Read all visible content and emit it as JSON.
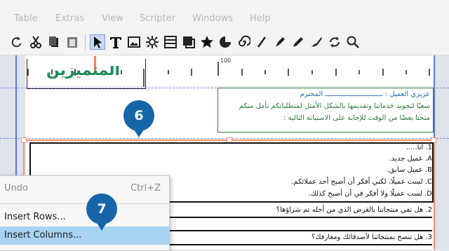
{
  "menubar": {
    "items": [
      {
        "label": "Table"
      },
      {
        "label": "Extras"
      },
      {
        "label": "View"
      },
      {
        "label": "Scripter"
      },
      {
        "label": "Windows"
      },
      {
        "label": "Help"
      }
    ]
  },
  "toolbar": {
    "buttons": [
      {
        "icon": "rotate-icon"
      },
      {
        "icon": "cut-icon"
      },
      {
        "icon": "copy-icon"
      },
      {
        "icon": "paste-icon"
      },
      {
        "icon": "select-arrow-icon"
      },
      {
        "icon": "text-frame-icon"
      },
      {
        "icon": "image-frame-icon"
      },
      {
        "icon": "render-frame-icon"
      },
      {
        "icon": "table-icon"
      },
      {
        "icon": "shape-icon"
      },
      {
        "icon": "star-icon"
      },
      {
        "icon": "arc-icon"
      },
      {
        "icon": "spiral-icon"
      },
      {
        "icon": "line-icon"
      },
      {
        "icon": "bezier-pen-icon"
      },
      {
        "icon": "freehand-pencil-icon"
      },
      {
        "icon": "calligraphic-pen-icon"
      },
      {
        "icon": "rotate-item-icon"
      },
      {
        "icon": "zoom-icon"
      }
    ]
  },
  "ruler": {
    "label": "100"
  },
  "document": {
    "logo_text": "المتميزين",
    "greeting": [
      "عزيزي العميل : ــــــــــــــــــــــــــــ المحترم",
      "سعيًا لتجويد خدماتنا وتقديمها بالشكل الأمثل لمتطلباتكم نأمل منكم",
      "منحنا بعضًا من الوقت للإجابة على الاستبانة التالية :"
    ],
    "questions": [
      "1. أنا.....",
      "A. عميل جديد.",
      "B. عميل سابق.",
      "C. لست عميلًا، لكني أفكر أن أصبح أحد عملائكم.",
      "D. لست عميلًا ولا أفكر في أن أصبح كذلك.",
      "2. هل تفي منتجاتنا بالغرض الذي من أجله تم شراؤها؟",
      "3. هل تنصح بمنتجاتنا لأصدقائك ومعارفك؟"
    ]
  },
  "badges": {
    "step_a": "6",
    "step_b": "7"
  },
  "context_menu": {
    "items": [
      {
        "label": "Undo",
        "shortcut": "Ctrl+Z"
      },
      {
        "label": "Insert Rows...",
        "shortcut": ""
      },
      {
        "label": "Insert Columns...",
        "shortcut": ""
      }
    ]
  },
  "colors": {
    "accent_badge": "#1565a8",
    "selection_frame": "#ff8c6b",
    "menu_highlight": "#a9d3f2",
    "guide": "#5c77e6",
    "logo_green": "#1e8c5a"
  }
}
